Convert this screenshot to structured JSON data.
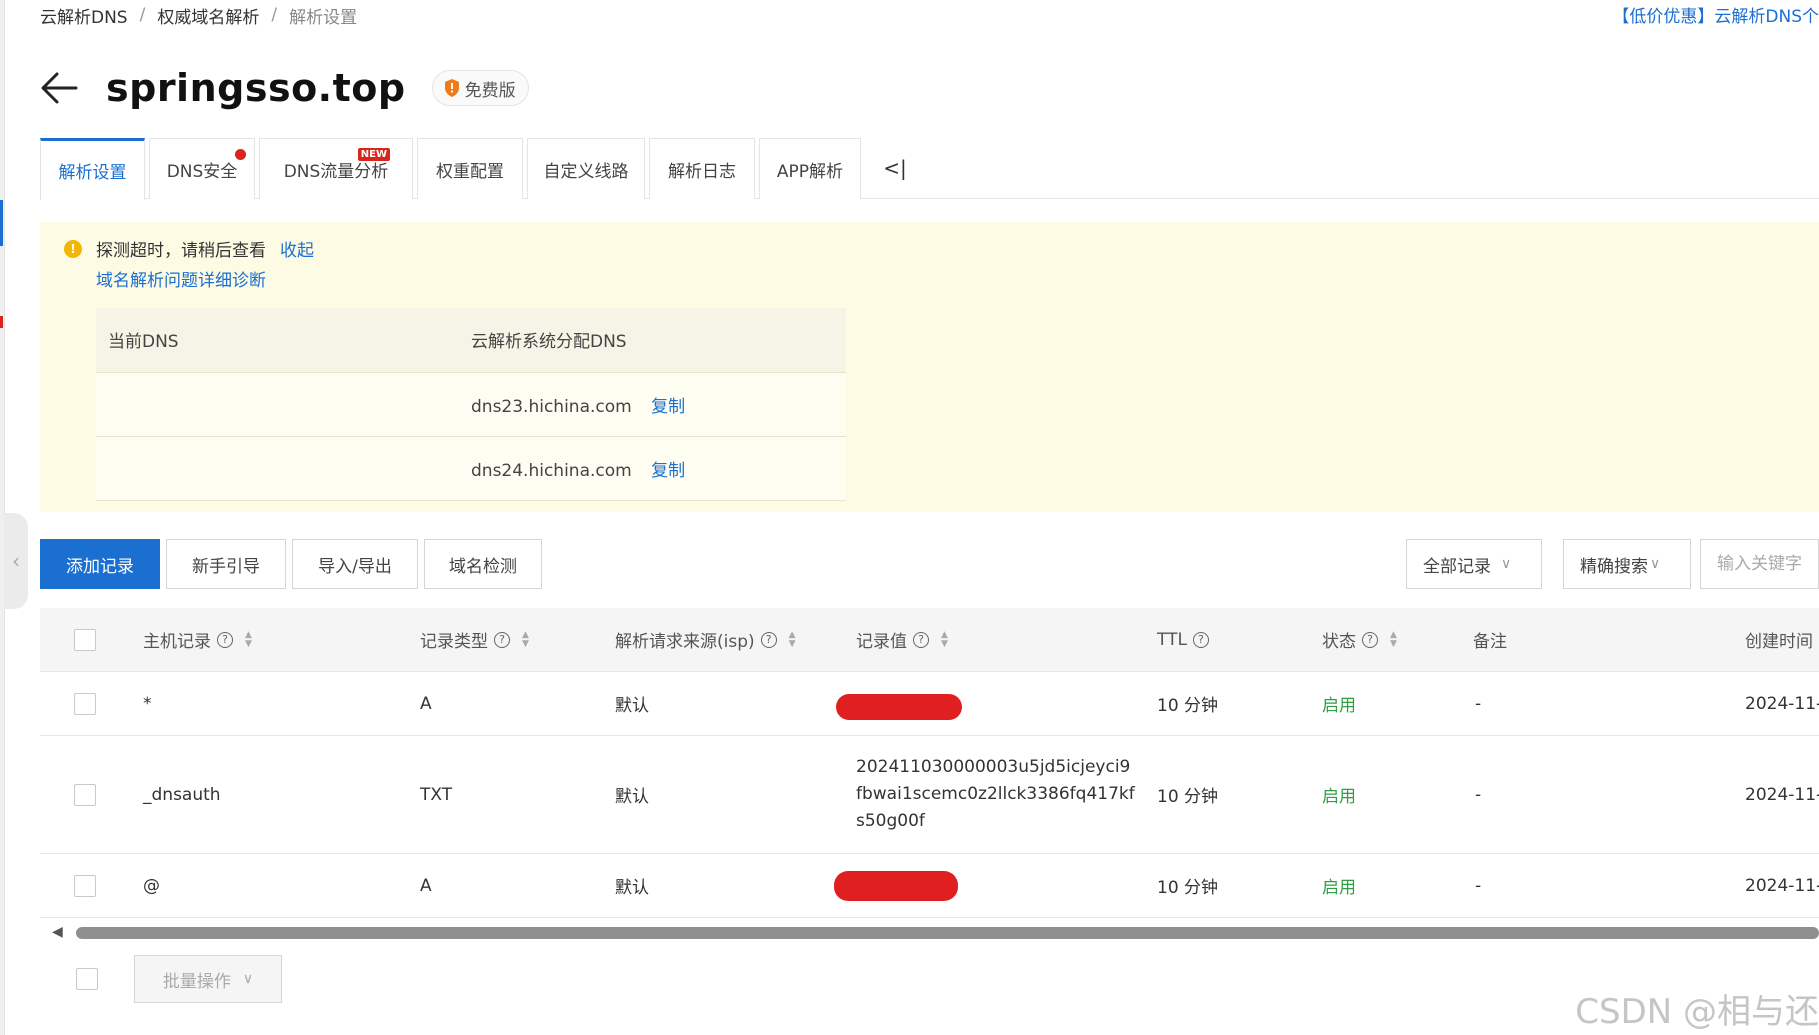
{
  "breadcrumb": [
    "云解析DNS",
    "权威域名解析",
    "解析设置"
  ],
  "promo_link": "【低价优惠】云解析DNS个",
  "domain": {
    "name": "springsso.top",
    "plan_badge": "免费版"
  },
  "tabs": [
    {
      "label": "解析设置",
      "active": true
    },
    {
      "label": "DNS安全",
      "dot": true
    },
    {
      "label": "DNS流量分析",
      "tag": "NEW"
    },
    {
      "label": "权重配置"
    },
    {
      "label": "自定义线路"
    },
    {
      "label": "解析日志"
    },
    {
      "label": "APP解析"
    }
  ],
  "tabs_collapse_label": "<|",
  "alert": {
    "message": "探测超时，请稍后查看",
    "collapse_link": "收起",
    "diagnose_link": "域名解析问题详细诊断",
    "table_headers": [
      "当前DNS",
      "云解析系统分配DNS"
    ],
    "assigned_dns": [
      "dns23.hichina.com",
      "dns24.hichina.com"
    ],
    "copy_label": "复制"
  },
  "toolbar": {
    "add_record": "添加记录",
    "guide": "新手引导",
    "import_export": "导入/导出",
    "domain_check": "域名检测",
    "filter_select": "全部记录",
    "search_mode": "精确搜索",
    "search_placeholder": "输入关键字"
  },
  "records": {
    "headers": [
      "主机记录",
      "记录类型",
      "解析请求来源(isp)",
      "记录值",
      "TTL",
      "状态",
      "备注",
      "创建时间"
    ],
    "rows": [
      {
        "host": "*",
        "type": "A",
        "isp": "默认",
        "value": "",
        "redacted": true,
        "ttl": "10 分钟",
        "status": "启用",
        "note": "-",
        "created": "2024-11-"
      },
      {
        "host": "_dnsauth",
        "type": "TXT",
        "isp": "默认",
        "value": "202411030000003u5jd5icjeyci9fbwai1scemc0z2llck3386fq417kfs50g00f",
        "redacted": false,
        "ttl": "10 分钟",
        "status": "启用",
        "note": "-",
        "created": "2024-11-"
      },
      {
        "host": "@",
        "type": "A",
        "isp": "默认",
        "value": "",
        "redacted": true,
        "ttl": "10 分钟",
        "status": "启用",
        "note": "-",
        "created": "2024-11-"
      }
    ]
  },
  "bulk_action": "批量操作",
  "watermark": "CSDN @相与还",
  "colors": {
    "accent": "#1b6fd0",
    "alert_bg": "#fdfbe4",
    "status_enabled": "#2f9e44",
    "redaction": "#e02020",
    "new_tag": "#d9261c"
  }
}
